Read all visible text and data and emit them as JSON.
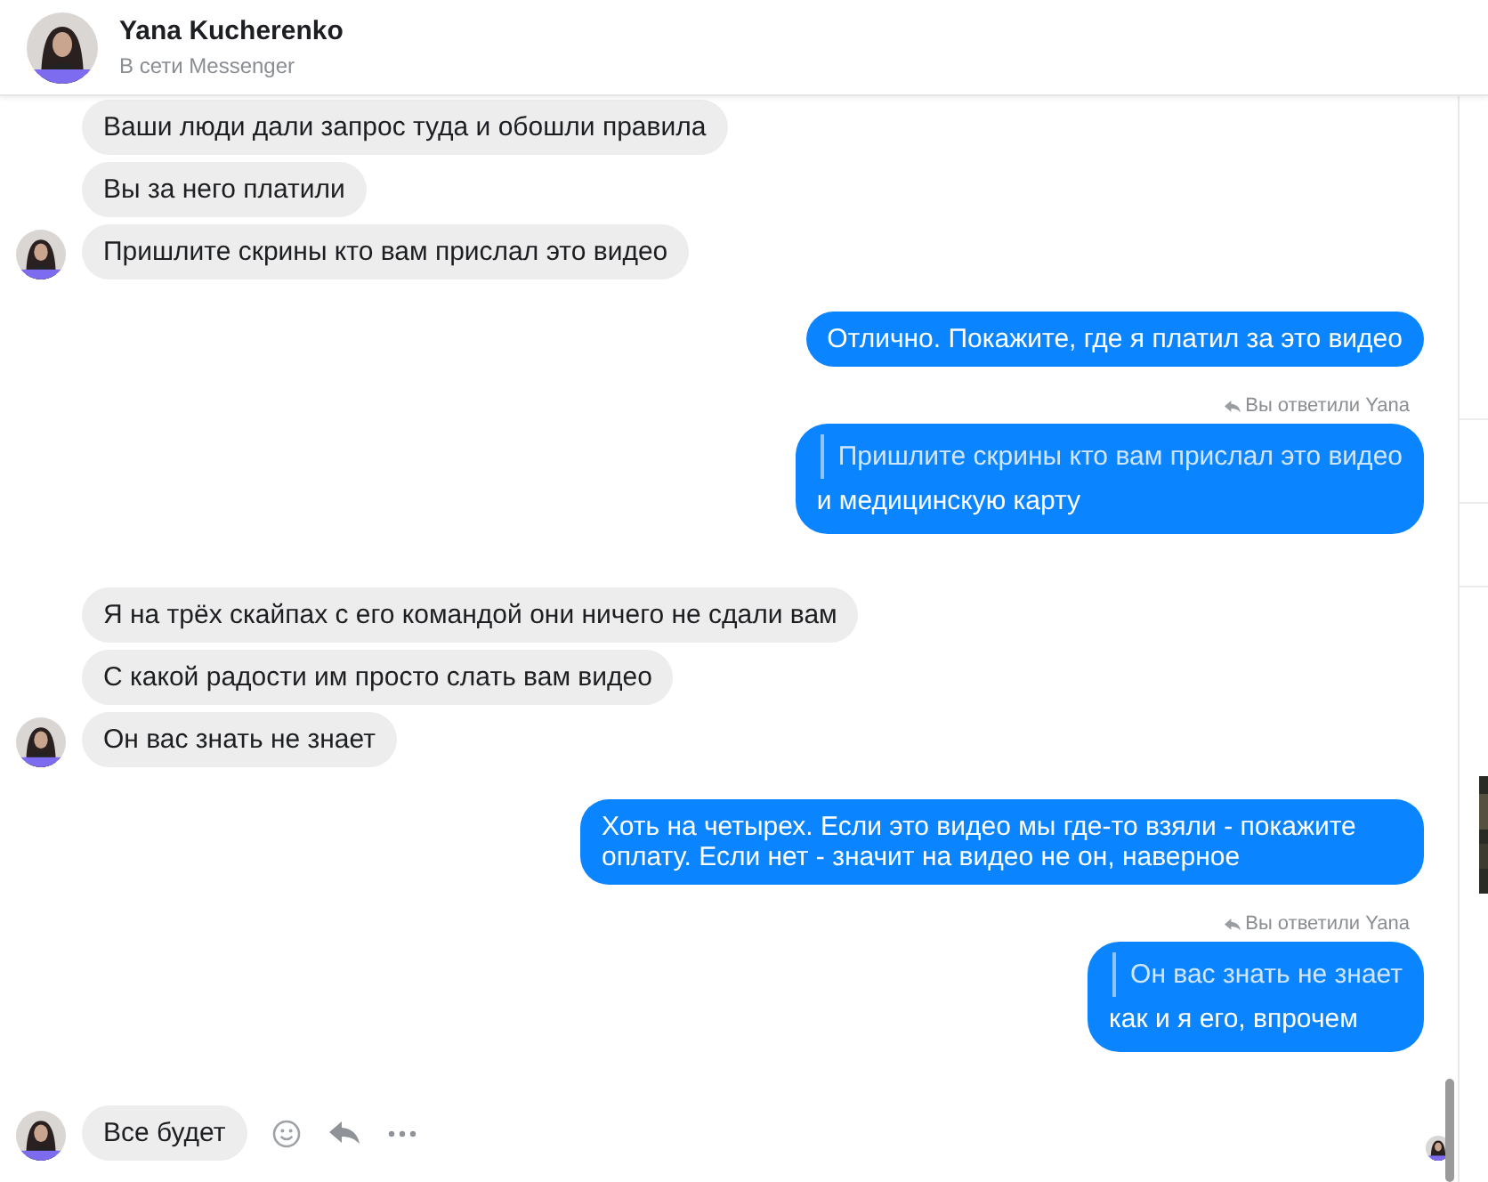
{
  "contact": {
    "name": "Yana Kucherenko",
    "status": "В сети Messenger"
  },
  "messages": [
    {
      "kind": "incoming",
      "avatar": false,
      "text": "Ваши люди дали запрос туда и обошли правила"
    },
    {
      "kind": "incoming",
      "avatar": false,
      "text": "Вы за него платили"
    },
    {
      "kind": "incoming",
      "avatar": true,
      "text": "Пришлите скрины кто вам прислал это видео"
    },
    {
      "kind": "outgoing",
      "text": "Отлично. Покажите, где я платил за это видео"
    },
    {
      "kind": "outgoing",
      "reply_label": "Вы ответили Yana",
      "quote": "Пришлите скрины кто вам прислал это видео",
      "text": "и медицинскую карту"
    },
    {
      "kind": "incoming",
      "avatar": false,
      "text": "Я на трёх скайпах с его командой они ничего не сдали вам"
    },
    {
      "kind": "incoming",
      "avatar": false,
      "text": "С какой радости им просто слать вам видео"
    },
    {
      "kind": "incoming",
      "avatar": true,
      "text": "Он вас знать не знает"
    },
    {
      "kind": "outgoing",
      "text": "Хоть на четырех. Если это видео мы где-то взяли - покажите оплату. Если нет - значит на видео не он, наверное"
    },
    {
      "kind": "outgoing",
      "reply_label": "Вы ответили Yana",
      "quote": "Он вас знать не знает",
      "text": "как и я его, впрочем"
    },
    {
      "kind": "incoming",
      "avatar": true,
      "actions": true,
      "seen": true,
      "text": "Все будет"
    }
  ]
}
